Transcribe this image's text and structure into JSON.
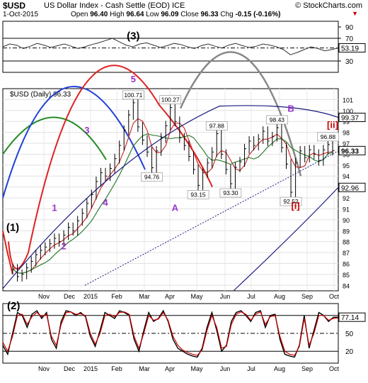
{
  "header": {
    "symbol": "$USD",
    "description": "US Dollar Index - Cash Settle (EOD) ICE",
    "brand": "© StockCharts.com",
    "date": "1-Oct-2015",
    "open_label": "Open",
    "open": "96.40",
    "high_label": "High",
    "high": "96.64",
    "low_label": "Low",
    "low": "96.09",
    "close_label": "Close",
    "close": "96.33",
    "chg_label": "Chg",
    "chg": "-0.15 (-0.16%)",
    "down_marker": "▼"
  },
  "chart_data": [
    {
      "type": "line",
      "name": "top-indicator",
      "yticks": [
        30,
        50,
        70,
        90
      ],
      "ylim": [
        10,
        100
      ],
      "reference_lines": [
        70,
        30
      ],
      "last_value_label": "53.19",
      "values": [
        55,
        60,
        58,
        52,
        56,
        61,
        58,
        54,
        57,
        60,
        56,
        52,
        55,
        59,
        62,
        66,
        70,
        64,
        58,
        55,
        60,
        62,
        58,
        54,
        57,
        61,
        59,
        55,
        52,
        57,
        60,
        56,
        53,
        58,
        61,
        57,
        54,
        56,
        60,
        58,
        55,
        50,
        41,
        45,
        50,
        55,
        52,
        48,
        50,
        53
      ]
    },
    {
      "type": "line",
      "title": "$USD (Daily) 96.33",
      "x_labels": [
        "Nov",
        "Dec",
        "2015",
        "Feb",
        "Mar",
        "Apr",
        "May",
        "Jun",
        "Jul",
        "Aug",
        "Sep",
        "Oct"
      ],
      "yticks": [
        84,
        85,
        86,
        87,
        88,
        89,
        90,
        91,
        92,
        93,
        94,
        95,
        96,
        97,
        98,
        99,
        100,
        101
      ],
      "ylim": [
        83.5,
        102
      ],
      "price_tags": [
        "99.37",
        "96.33",
        "92.96"
      ],
      "price_tag_values": [
        99.37,
        96.33,
        92.96
      ],
      "close": [
        85.5,
        84.8,
        85.0,
        85.6,
        86.2,
        86.8,
        87.2,
        87.5,
        87.8,
        88.3,
        88.0,
        88.6,
        89.3,
        89.0,
        89.9,
        90.6,
        91.5,
        92.3,
        93.5,
        94.3,
        94.0,
        94.7,
        95.6,
        96.8,
        98.2,
        99.6,
        100.71,
        98.5,
        97.3,
        96.2,
        94.76,
        96.3,
        97.5,
        98.6,
        100.27,
        99.0,
        97.5,
        96.8,
        95.8,
        94.6,
        93.15,
        94.3,
        95.2,
        96.2,
        97.88,
        96.0,
        94.6,
        93.3,
        94.8,
        95.3,
        96.5,
        97.2,
        96.8,
        97.4,
        98.1,
        97.2,
        97.6,
        98.43,
        96.6,
        95.1,
        92.52,
        95.2,
        96.3,
        95.7,
        96.4,
        96.0,
        95.4,
        96.4,
        96.88,
        96.33
      ],
      "point_labels": [
        {
          "text": "100.71",
          "index": 26,
          "value": 100.71,
          "pos": "above"
        },
        {
          "text": "100.27",
          "index": 34,
          "value": 100.27,
          "pos": "above"
        },
        {
          "text": "94.76",
          "index": 30,
          "value": 94.76,
          "pos": "below"
        },
        {
          "text": "93.15",
          "index": 40,
          "value": 93.15,
          "pos": "below"
        },
        {
          "text": "97.88",
          "index": 44,
          "value": 97.88,
          "pos": "above"
        },
        {
          "text": "93.30",
          "index": 47,
          "value": 93.3,
          "pos": "below"
        },
        {
          "text": "98.43",
          "index": 57,
          "value": 98.43,
          "pos": "above"
        },
        {
          "text": "92.52",
          "index": 60,
          "value": 92.52,
          "pos": "below"
        },
        {
          "text": "96.88",
          "index": 68,
          "value": 96.88,
          "pos": "above"
        }
      ],
      "wave_labels": [
        {
          "text": "(1)",
          "index": 0,
          "value": 89.0,
          "color": "#000000"
        },
        {
          "text": "1",
          "index": 9,
          "value": 90.8,
          "color": "#9933cc"
        },
        {
          "text": "2",
          "index": 11,
          "value": 87.3,
          "color": "#9933cc"
        },
        {
          "text": "3",
          "index": 16,
          "value": 97.9,
          "color": "#9933cc"
        },
        {
          "text": "4",
          "index": 20,
          "value": 91.3,
          "color": "#9933cc"
        },
        {
          "text": "5",
          "index": 26,
          "value": 102.6,
          "color": "#9933cc"
        },
        {
          "text": "(3)",
          "index": 26,
          "value": 106.5,
          "color": "#000000"
        },
        {
          "text": "A",
          "index": 35,
          "value": 90.8,
          "color": "#9933cc"
        },
        {
          "text": "B",
          "index": 60,
          "value": 99.9,
          "color": "#9933cc"
        },
        {
          "text": "[i]",
          "index": 61,
          "value": 91.0,
          "color": "#cc0000"
        },
        {
          "text": "[ii]",
          "index": 69,
          "value": 98.4,
          "color": "#cc0000"
        }
      ],
      "series_colors": {
        "price": "#000000",
        "ma_red": "#cc3333",
        "ma_green": "#2e7d32",
        "ma_blue": "#1a1a80",
        "channel": "#1a1a80"
      },
      "cycle_colors": [
        "#228b22",
        "#1f3fd6",
        "#dd2222",
        "#1f3fd6",
        "#888888"
      ]
    },
    {
      "type": "line",
      "name": "bottom-indicator",
      "label": "(2)",
      "yticks": [
        20,
        50,
        80
      ],
      "ylim": [
        0,
        100
      ],
      "reference_lines": [
        80,
        50,
        20
      ],
      "last_value_label": "77.14",
      "x_labels": [
        "Nov",
        "Dec",
        "2015",
        "Feb",
        "Mar",
        "Apr",
        "May",
        "Jun",
        "Jul",
        "Aug",
        "Sep",
        "Oct"
      ],
      "values": [
        30,
        15,
        50,
        85,
        80,
        60,
        82,
        88,
        75,
        85,
        40,
        25,
        70,
        88,
        86,
        80,
        85,
        78,
        45,
        28,
        55,
        85,
        80,
        75,
        88,
        85,
        80,
        40,
        20,
        55,
        85,
        70,
        75,
        88,
        70,
        40,
        25,
        20,
        15,
        12,
        10,
        25,
        60,
        85,
        55,
        20,
        30,
        70,
        85,
        88,
        80,
        70,
        85,
        88,
        60,
        80,
        82,
        40,
        15,
        12,
        10,
        30,
        80,
        25,
        55,
        85,
        80,
        70,
        77,
        77.14
      ],
      "k_values": [
        35,
        20,
        45,
        80,
        82,
        65,
        78,
        85,
        78,
        82,
        45,
        30,
        65,
        85,
        86,
        82,
        83,
        80,
        50,
        32,
        50,
        80,
        82,
        78,
        85,
        86,
        82,
        45,
        25,
        50,
        80,
        72,
        74,
        85,
        72,
        45,
        30,
        22,
        18,
        15,
        13,
        22,
        55,
        80,
        60,
        25,
        28,
        65,
        82,
        86,
        82,
        72,
        82,
        86,
        65,
        78,
        80,
        45,
        20,
        15,
        13,
        28,
        75,
        30,
        50,
        80,
        80,
        72,
        75,
        76
      ]
    }
  ],
  "x_axis": {
    "labels": [
      "Nov",
      "Dec",
      "2015",
      "Feb",
      "Mar",
      "Apr",
      "May",
      "Jun",
      "Jul",
      "Aug",
      "Sep",
      "Oct"
    ]
  }
}
